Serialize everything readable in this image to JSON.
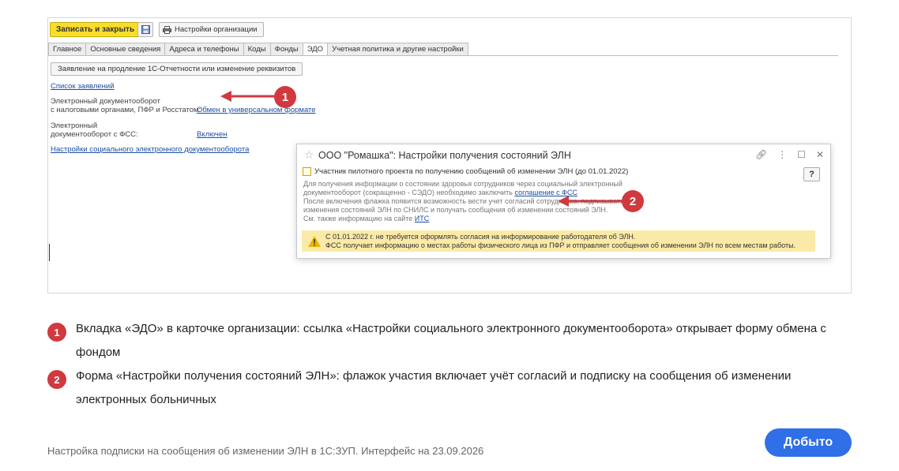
{
  "toolbar": {
    "save_close": "Записать и закрыть",
    "save_icon": "floppy-disk-icon",
    "org_settings": "Настройки организации",
    "printer_icon": "printer-icon"
  },
  "tabs": [
    "Главное",
    "Основные сведения",
    "Адреса и телефоны",
    "Коды",
    "Фонды",
    "ЭДО",
    "Учетная политика и другие настройки"
  ],
  "active_tab": "ЭДО",
  "edo": {
    "renew_button": "Заявление на продление 1С-Отчетности или изменение реквизитов",
    "list_link": "Список заявлений",
    "doc_tax_label_1": "Электронный документооборот",
    "doc_tax_label_2": "с налоговыми органами, ПФР и Росстатом:",
    "doc_tax_value": "Обмен в универсальном формате",
    "doc_fss_label_1": "Электронный",
    "doc_fss_label_2": "документооборот с ФСС:",
    "doc_fss_value": "Включен",
    "social_settings_link": "Настройки социального электронного документооборота"
  },
  "dialog": {
    "title": "ООО \"Ромашка\": Настройки получения состояний ЭЛН",
    "star_icon": "star-icon",
    "link_icon": "link-icon",
    "more_icon": "more-vertical-icon",
    "maximize_icon": "maximize-icon",
    "close_icon": "close-icon",
    "help": "?",
    "checkbox_label": "Участник пилотного проекта по получению сообщений об изменении ЭЛН (до 01.01.2022)",
    "body_line_1": "Для получения информации о состоянии здоровья сотрудников через социальный электронный",
    "body_line_2_prefix": "документооборот (сокращенно - СЭДО) необходимо заключить ",
    "body_line_2_link": "соглашение с ФСС",
    "body_line_3": "После включения флажка появится возможность вести учет согласий сотрудников, подписываться на",
    "body_line_4": "изменения состояний ЭЛН по СНИЛС и получать сообщения об изменении состояний ЭЛН.",
    "body_line_5_prefix": "См. также информацию на сайте ",
    "body_line_5_link": "ИТС",
    "warning_icon": "warning-icon",
    "warning_line_1": "С 01.01.2022 г. не требуется оформлять согласия на информирование работодателя об ЭЛН.",
    "warning_line_2": "ФСС получает информацию о местах работы физического лица из ПФР и отправляет сообщения об изменении ЭЛН по всем местам работы."
  },
  "markers": [
    "1",
    "2"
  ],
  "legend": [
    {
      "num": "1",
      "text": "Вкладка «ЭДО» в карточке организации: ссылка «Настройки социального электронного документооборота» открывает форму обмена с фондом"
    },
    {
      "num": "2",
      "text": "Форма «Настройки получения состояний ЭЛН»: флажок участия включает учёт согласий и подписку на сообщения об изменении электронных больничных"
    }
  ],
  "caption": "Настройка подписки на сообщения об изменении ЭЛН в 1С:ЗУП. Интерфейс на 23.09.2026",
  "cta": "Добыто",
  "colors": {
    "accent_red": "#d0393e",
    "cta_blue": "#2f6fe7",
    "save_yellow": "#f8dd2c",
    "link_blue": "#1a4ea1",
    "warning_bg": "#fbeaa7"
  }
}
